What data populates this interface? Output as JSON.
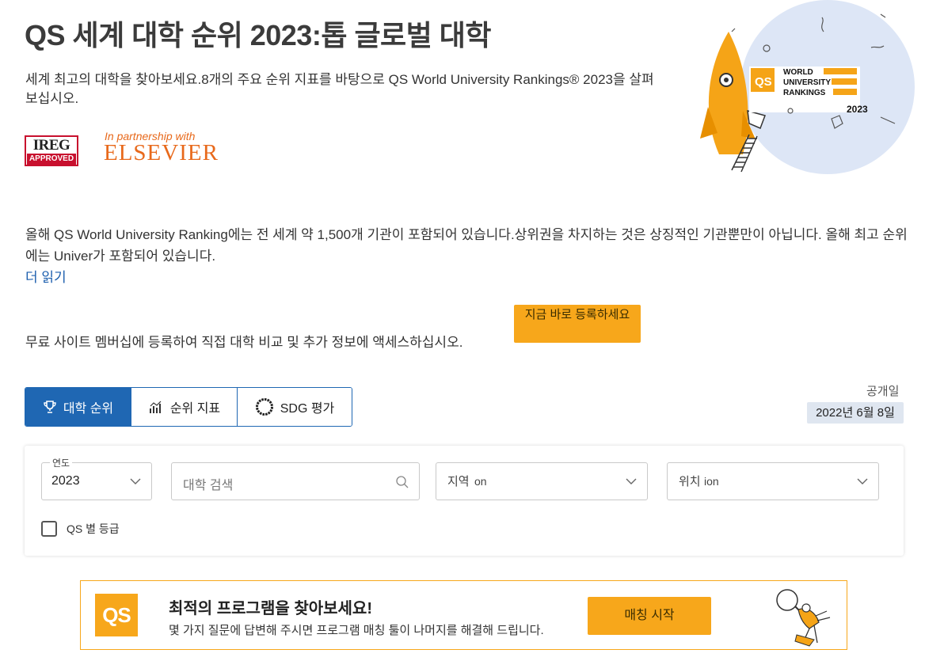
{
  "header": {
    "title": "QS 세계 대학 순위 2023:톱 글로벌 대학",
    "intro": "세계 최고의 대학을 찾아보세요.8개의 주요 순위 지표를 바탕으로 QS World University Rankings® 2023을 살펴보십시오."
  },
  "partners": {
    "ireg_top": "IREG",
    "ireg_bottom": "APPROVED",
    "partnership_text": "In partnership with",
    "elsevier": "ELSEVIER"
  },
  "hero": {
    "badge_logo": "QS",
    "badge_lines": [
      "WORLD",
      "UNIVERSITY",
      "RANKINGS"
    ],
    "badge_year": "2023"
  },
  "description": {
    "text": "올해 QS World University Ranking에는 전 세계 약 1,500개 기관이 포함되어 있습니다.상위권을 차지하는 것은 상징적인 기관뿐만이 아닙니다. 올해 최고 순위에는 Univer가 포함되어 있습니다.",
    "read_more": "더 읽기"
  },
  "signup": {
    "text": "무료 사이트 멤버십에 등록하여 직접 대학 비교 및 추가 정보에 액세스하십시오.",
    "button": "지금 바로 등록하세요"
  },
  "tabs": [
    {
      "label": "대학 순위",
      "icon": "trophy-icon"
    },
    {
      "label": "순위 지표",
      "icon": "bar-chart-icon"
    },
    {
      "label": "SDG 평가",
      "icon": "sdg-wheel-icon"
    }
  ],
  "release": {
    "label": "공개일",
    "date": "2022년 6월 8일"
  },
  "filters": {
    "year_legend": "연도",
    "year_value": "2023",
    "search_placeholder": "대학 검색",
    "region_label": "지역",
    "region_fragment": "on",
    "location_label": "위치",
    "location_fragment": "ion",
    "checkbox_label": "QS 별 등급"
  },
  "promo": {
    "logo": "QS",
    "title": "최적의 프로그램을 찾아보세요!",
    "subtitle": "몇 가지 질문에 답변해 주시면 프로그램 매칭 툴이 나머지를 해결해 드립니다.",
    "button": "매칭 시작"
  },
  "colors": {
    "primary_blue": "#1f67b3",
    "accent_orange": "#f7a71b",
    "elsevier_orange": "#e8691b",
    "ireg_red": "#c8102e"
  }
}
